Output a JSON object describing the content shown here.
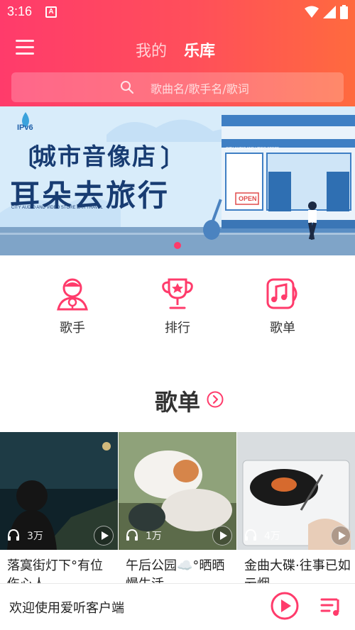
{
  "status": {
    "time": "3:16",
    "notif": "A"
  },
  "nav": {
    "tab_mine": "我的",
    "tab_library": "乐库"
  },
  "search": {
    "placeholder": "歌曲名/歌手名/歌词"
  },
  "banner": {
    "badge": "IPv6",
    "title_line1": "城市音像店",
    "title_line2": "耳朵去旅行",
    "store_sign": "CITY AUDIO AND VIDEO STORE",
    "open_sign": "OPEN",
    "subtitle": "CITY AUDIO AND VIDEO STORE EAR TRAVEL"
  },
  "categories": [
    {
      "label": "歌手",
      "icon": "singer-icon"
    },
    {
      "label": "排行",
      "icon": "trophy-icon"
    },
    {
      "label": "歌单",
      "icon": "playlist-icon"
    }
  ],
  "section": {
    "title": "歌单"
  },
  "playlists": [
    {
      "count": "3万",
      "title": "落寞街灯下°有位伤心人"
    },
    {
      "count": "1万",
      "title": "午后公园☁️°晒晒慢生活"
    },
    {
      "count": "4万",
      "title": "金曲大碟·往事已如云烟"
    }
  ],
  "player": {
    "text": "欢迎使用爱听客户端"
  },
  "colors": {
    "accent": "#ff3b6b",
    "accent2": "#ff6a3e"
  }
}
